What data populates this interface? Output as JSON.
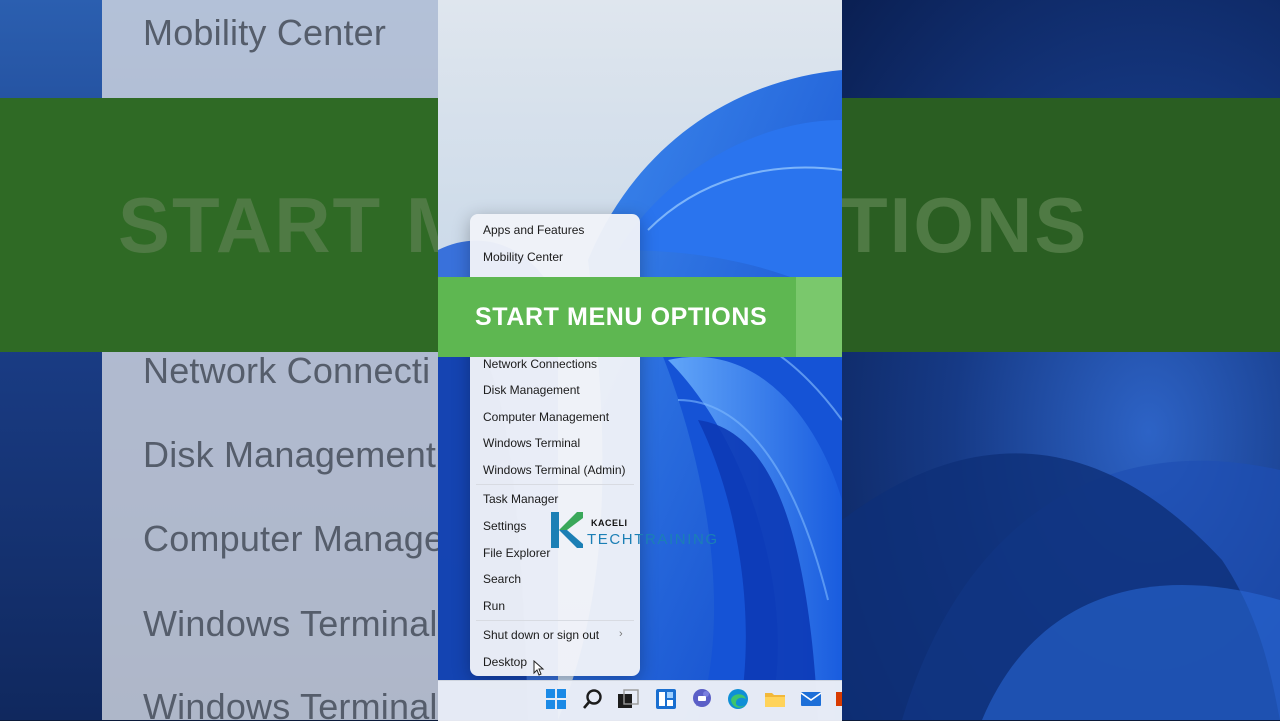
{
  "background": {
    "left_items": [
      "Mobility Center",
      "Network Connecti",
      "Disk Management",
      "Computer Manage",
      "Windows Terminal",
      "Windows Terminal"
    ],
    "big_left": "START M",
    "big_right": "TIONS"
  },
  "banner": {
    "title": "START MENU OPTIONS",
    "color": "#5eb751"
  },
  "menu": {
    "items": [
      "Apps and Features",
      "Mobility Center",
      "Network Connections",
      "Disk Management",
      "Computer Management",
      "Windows Terminal",
      "Windows Terminal (Admin)",
      "Task Manager",
      "Settings",
      "File Explorer",
      "Search",
      "Run",
      "Shut down or sign out",
      "Desktop"
    ]
  },
  "watermark": {
    "top": "KACELI",
    "bottom": "TECHTRAINING"
  },
  "taskbar": {
    "icons": [
      "start-icon",
      "search-icon",
      "task-view-icon",
      "widgets-icon",
      "chat-icon",
      "edge-icon",
      "file-explorer-icon",
      "mail-icon",
      "office-icon"
    ]
  }
}
